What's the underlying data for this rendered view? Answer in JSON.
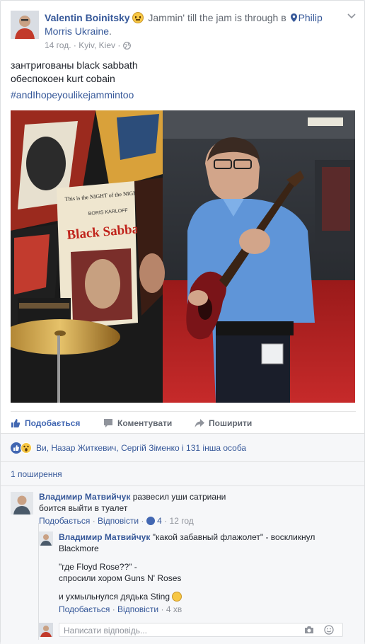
{
  "post": {
    "author": "Valentin Boinitsky",
    "feeling_text": "Jammin' till the jam is through",
    "at_word": "в",
    "place": "Philip Morris Ukraine",
    "place_suffix": ".",
    "time": "14 год.",
    "separator": "·",
    "location": "Kyiv, Kiev",
    "separator2": "·",
    "text_lines": [
      "зантригованы black sabbath",
      "обеспокоен kurt cobain"
    ],
    "hashtag": "#andIhopeyoulikejammintoo"
  },
  "photo": {
    "poster_top": "This is the NIGHT of the NIGHTMARE!",
    "poster_small": "BORIS KARLOFF",
    "poster_title": "Black Sabbath"
  },
  "actions": {
    "like": "Подобається",
    "comment": "Коментувати",
    "share": "Поширити"
  },
  "reactions": {
    "text": "Ви, Назар Житкевич, Сергій Зіменко і 131 інша особа"
  },
  "shares": {
    "text": "1 поширення"
  },
  "comments": [
    {
      "author": "Владимир Матвийчук",
      "line1": "развесил уши сатриани",
      "line2": "боится выйти в туалет",
      "like_label": "Подобається",
      "dot": "·",
      "reply_label": "Відповісти",
      "dot2": "·",
      "likes": "4",
      "dot3": "·",
      "time": "12 год"
    }
  ],
  "reply": {
    "author": "Владимир Матвийчук",
    "line1": "\"какой забавный флажолет\" - воскликнул",
    "line2": "Blackmore",
    "line3": "\"где Floyd Rose??\" -",
    "line4": "спросили хором Guns N' Roses",
    "line5": "и ухмыльнулся дядька Sting",
    "like_label": "Подобається",
    "dot": "·",
    "reply_label": "Відповісти",
    "dot2": "·",
    "time": "4 хв"
  },
  "reply_input": {
    "placeholder": "Написати відповідь..."
  },
  "colors": {
    "link": "#365899",
    "accent": "#4267b2",
    "meta": "#90949c"
  }
}
